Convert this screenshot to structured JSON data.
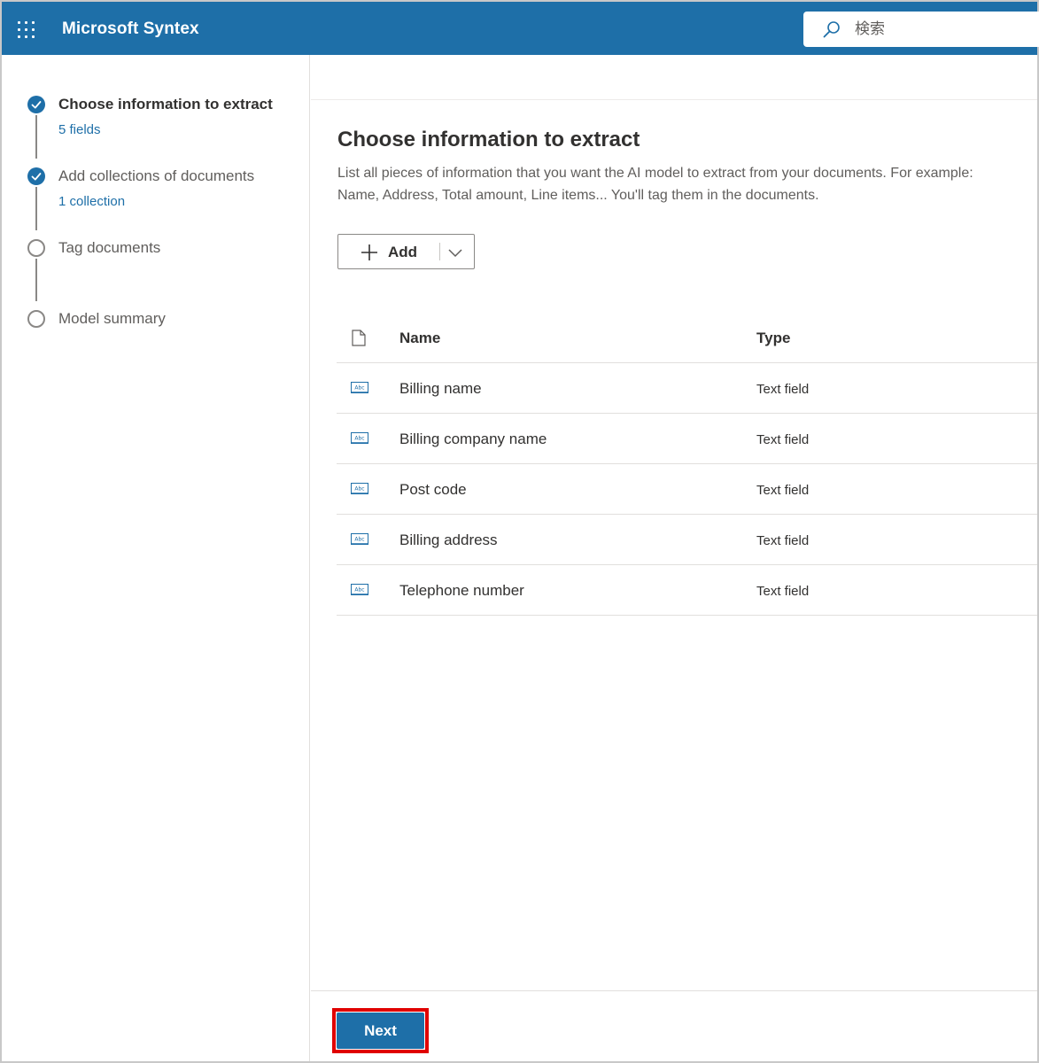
{
  "app": {
    "title": "Microsoft Syntex",
    "search_placeholder": "検索",
    "accent_color": "#1e6fa8",
    "highlight_color": "#e00000"
  },
  "steps": [
    {
      "title": "Choose information to extract",
      "subtitle": "5 fields",
      "status": "done",
      "active": true
    },
    {
      "title": "Add collections of documents",
      "subtitle": "1 collection",
      "status": "done",
      "active": false
    },
    {
      "title": "Tag documents",
      "subtitle": "",
      "status": "todo",
      "active": false
    },
    {
      "title": "Model summary",
      "subtitle": "",
      "status": "todo",
      "active": false
    }
  ],
  "main": {
    "title": "Choose information to extract",
    "description": "List all pieces of information that you want the AI model to extract from your documents. For example: Name, Address, Total amount, Line items... You'll tag them in the documents.",
    "add_button": {
      "label": "Add",
      "icon": "plus-icon",
      "menu_icon": "chevron-down-icon"
    }
  },
  "table": {
    "header_icon": "document-icon",
    "columns": [
      "Name",
      "Type"
    ],
    "rows": [
      {
        "icon": "text-field-icon",
        "name": "Billing name",
        "type": "Text field"
      },
      {
        "icon": "text-field-icon",
        "name": "Billing company name",
        "type": "Text field"
      },
      {
        "icon": "text-field-icon",
        "name": "Post code",
        "type": "Text field"
      },
      {
        "icon": "text-field-icon",
        "name": "Billing address",
        "type": "Text field"
      },
      {
        "icon": "text-field-icon",
        "name": "Telephone number",
        "type": "Text field"
      }
    ]
  },
  "footer": {
    "next_label": "Next"
  }
}
